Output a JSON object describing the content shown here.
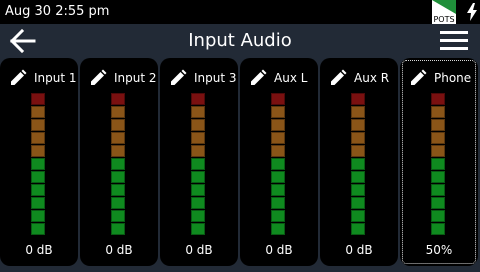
{
  "status": {
    "time": "Aug 30 2:55 pm",
    "badge_label": "POTS",
    "badge_color": "#1f8f3a",
    "charge_icon": "lightning-icon"
  },
  "header": {
    "title": "Input Audio",
    "back_icon": "arrow-left-icon",
    "menu_icon": "hamburger-menu-icon"
  },
  "colors": {
    "background": "#222a36",
    "card": "#000000",
    "seg_red": "#7a1010",
    "seg_orange": "#8a5518",
    "seg_green": "#0f8a1f"
  },
  "meter_segments": [
    "red",
    "orange",
    "orange",
    "orange",
    "orange",
    "green",
    "green",
    "green",
    "green",
    "green",
    "green"
  ],
  "channels": [
    {
      "name": "Input 1",
      "value": "0 dB",
      "icon": "pencil-icon",
      "selected": false
    },
    {
      "name": "Input 2",
      "value": "0 dB",
      "icon": "pencil-icon",
      "selected": false
    },
    {
      "name": "Input 3",
      "value": "0 dB",
      "icon": "pencil-icon",
      "selected": false
    },
    {
      "name": "Aux L",
      "value": "0 dB",
      "icon": "pencil-icon",
      "selected": false
    },
    {
      "name": "Aux R",
      "value": "0 dB",
      "icon": "pencil-icon",
      "selected": false
    },
    {
      "name": "Phone",
      "value": "50%",
      "icon": "pencil-icon",
      "selected": true
    }
  ]
}
